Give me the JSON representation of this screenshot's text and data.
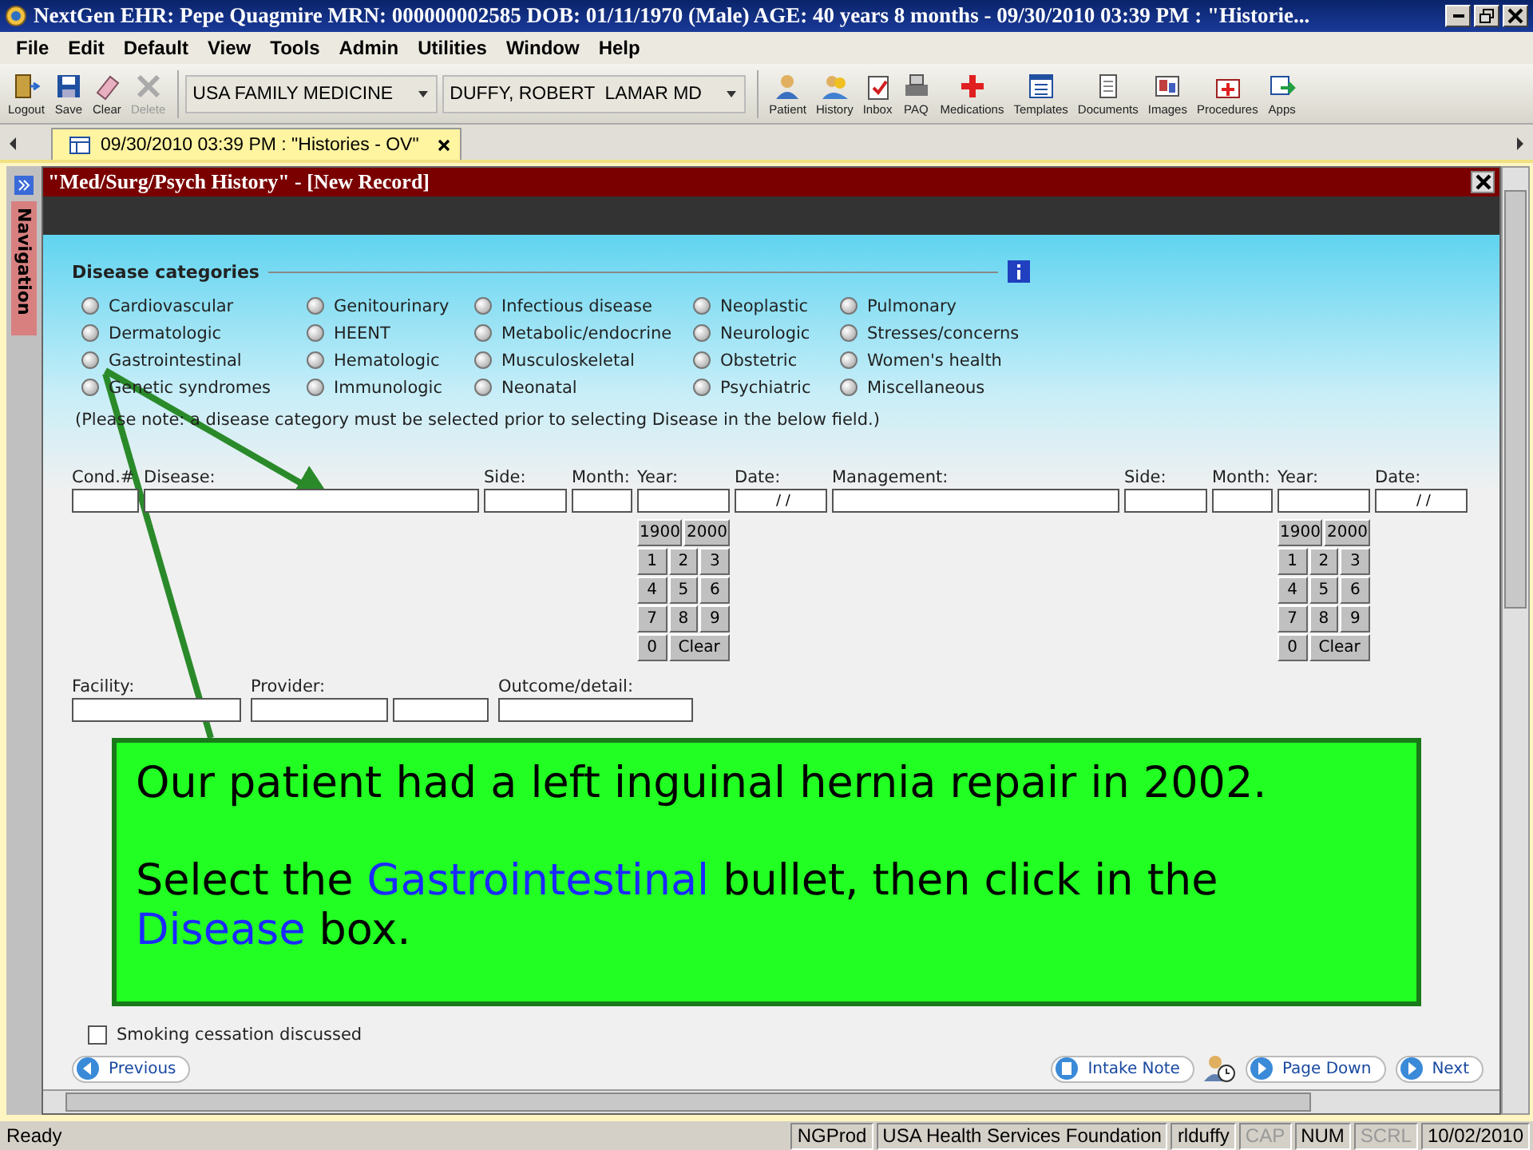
{
  "window": {
    "title": "NextGen EHR: Pepe Quagmire  MRN: 000000002585  DOB: 01/11/1970  (Male)  AGE: 40 years 8 months - 09/30/2010 03:39 PM : \"Historie..."
  },
  "menu": [
    "File",
    "Edit",
    "Default",
    "View",
    "Tools",
    "Admin",
    "Utilities",
    "Window",
    "Help"
  ],
  "toolbar": {
    "left_buttons": [
      {
        "label": "Logout",
        "disabled": false
      },
      {
        "label": "Save",
        "disabled": false
      },
      {
        "label": "Clear",
        "disabled": false
      },
      {
        "label": "Delete",
        "disabled": true
      }
    ],
    "dropdowns": [
      {
        "value": "USA FAMILY MEDICINE"
      },
      {
        "value": "DUFFY, ROBERT  LAMAR MD"
      }
    ],
    "right_buttons": [
      {
        "label": "Patient"
      },
      {
        "label": "History"
      },
      {
        "label": "Inbox"
      },
      {
        "label": "PAQ"
      },
      {
        "label": "Medications"
      },
      {
        "label": "Templates"
      },
      {
        "label": "Documents"
      },
      {
        "label": "Images"
      },
      {
        "label": "Procedures"
      },
      {
        "label": "Apps"
      }
    ]
  },
  "tabs": [
    {
      "label": "09/30/2010 03:39 PM : \"Histories - OV\"",
      "selected": true
    }
  ],
  "sidebar": {
    "label": "Navigation"
  },
  "document": {
    "title": "\"Med/Surg/Psych History\" - [New Record]",
    "section_title": "Disease categories",
    "categories": [
      {
        "label": "Cardiovascular",
        "selected": false
      },
      {
        "label": "Dermatologic",
        "selected": false
      },
      {
        "label": "Gastrointestinal",
        "selected": false
      },
      {
        "label": "Genetic syndromes",
        "selected": false
      },
      {
        "label": "Genitourinary",
        "selected": false
      },
      {
        "label": "HEENT",
        "selected": false
      },
      {
        "label": "Hematologic",
        "selected": false
      },
      {
        "label": "Immunologic",
        "selected": false
      },
      {
        "label": "Infectious disease",
        "selected": false
      },
      {
        "label": "Metabolic/endocrine",
        "selected": false
      },
      {
        "label": "Musculoskeletal",
        "selected": false
      },
      {
        "label": "Neonatal",
        "selected": false
      },
      {
        "label": "Neoplastic",
        "selected": false
      },
      {
        "label": "Neurologic",
        "selected": false
      },
      {
        "label": "Obstetric",
        "selected": false
      },
      {
        "label": "Psychiatric",
        "selected": false
      },
      {
        "label": "Pulmonary",
        "selected": false
      },
      {
        "label": "Stresses/concerns",
        "selected": false
      },
      {
        "label": "Women's health",
        "selected": false
      },
      {
        "label": "Miscellaneous",
        "selected": false
      }
    ],
    "note": "(Please note: a disease category must be selected prior to selecting Disease in the below field.)",
    "fields": [
      {
        "label": "Cond.#"
      },
      {
        "label": "Disease:"
      },
      {
        "label": "Side:"
      },
      {
        "label": "Month:"
      },
      {
        "label": "Year:",
        "keypad": [
          "1900",
          "2000",
          "1",
          "2",
          "3",
          "4",
          "5",
          "6",
          "7",
          "8",
          "9",
          "0",
          "Clear"
        ]
      },
      {
        "label": "Date:",
        "value": " / /"
      },
      {
        "label": "Management:"
      },
      {
        "label": "Side:"
      },
      {
        "label": "Month:"
      },
      {
        "label": "Year:",
        "keypad": [
          "1900",
          "2000",
          "1",
          "2",
          "3",
          "4",
          "5",
          "6",
          "7",
          "8",
          "9",
          "0",
          "Clear"
        ]
      },
      {
        "label": "Date:",
        "value": " / /"
      }
    ],
    "detail_fields": [
      {
        "label": "Facility:"
      },
      {
        "label": "Provider:"
      },
      {
        "label": "Outcome/detail:"
      }
    ],
    "checkbox": {
      "label": "Smoking cessation discussed",
      "checked": false
    },
    "nav_buttons": {
      "previous": "Previous",
      "intake": "Intake Note",
      "page_down": "Page Down",
      "next": "Next"
    }
  },
  "callout": {
    "line_1": [
      {
        "text": "Our patient had a left inguinal hernia repair in 2002.",
        "highlight": false
      }
    ],
    "line_2": [
      {
        "text": "Select the ",
        "highlight": false
      },
      {
        "text": "Gastrointestinal",
        "highlight": true
      },
      {
        "text": " bullet, then click in the ",
        "highlight": false
      },
      {
        "text": "Disease",
        "highlight": true
      },
      {
        "text": " box.",
        "highlight": false
      }
    ]
  },
  "status_bar": [
    {
      "text": "Ready",
      "disabled": false
    },
    {
      "text": "NGProd",
      "disabled": false
    },
    {
      "text": "USA Health Services Foundation",
      "disabled": false
    },
    {
      "text": "rlduffy",
      "disabled": false
    },
    {
      "text": "CAP",
      "disabled": true
    },
    {
      "text": "NUM",
      "disabled": false
    },
    {
      "text": "SCRL",
      "disabled": true
    },
    {
      "text": "10/02/2010",
      "disabled": false
    }
  ]
}
